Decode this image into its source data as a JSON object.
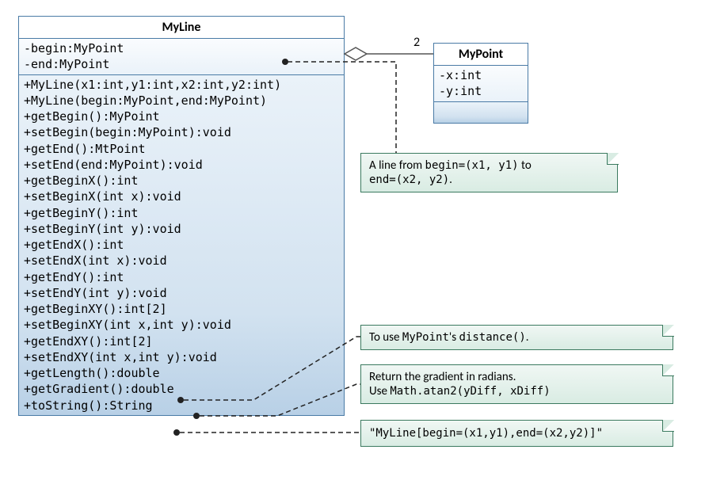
{
  "myline": {
    "title": "MyLine",
    "attrs": [
      "-begin:MyPoint",
      "-end:MyPoint"
    ],
    "methods": [
      "+MyLine(x1:int,y1:int,x2:int,y2:int)",
      "+MyLine(begin:MyPoint,end:MyPoint)",
      "+getBegin():MyPoint",
      "+setBegin(begin:MyPoint):void",
      "+getEnd():MtPoint",
      "+setEnd(end:MyPoint):void",
      "+getBeginX():int",
      "+setBeginX(int x):void",
      "+getBeginY():int",
      "+setBeginY(int y):void",
      "+getEndX():int",
      "+setEndX(int x):void",
      "+getEndY():int",
      "+setEndY(int y):void",
      "+getBeginXY():int[2]",
      "+setBeginXY(int x,int y):void",
      "+getEndXY():int[2]",
      "+setEndXY(int x,int y):void",
      "+getLength():double",
      "+getGradient():double",
      "+toString():String"
    ]
  },
  "mypoint": {
    "title": "MyPoint",
    "attrs": [
      "-x:int",
      "-y:int"
    ]
  },
  "multiplicity": "2",
  "notes": {
    "n1_a": "A line from ",
    "n1_b": "begin=(x1, y1)",
    "n1_c": " to ",
    "n1_d": "end=(x2, y2)",
    "n1_e": ".",
    "n2_a": "To use ",
    "n2_b": "MyPoint",
    "n2_c": "'s ",
    "n2_d": "distance()",
    "n2_e": ".",
    "n3_a": "Return the gradient in radians.",
    "n3_b": "Use ",
    "n3_c": "Math.atan2(yDiff, xDiff)",
    "n4": "\"MyLine[begin=(x1,y1),end=(x2,y2)]\""
  }
}
